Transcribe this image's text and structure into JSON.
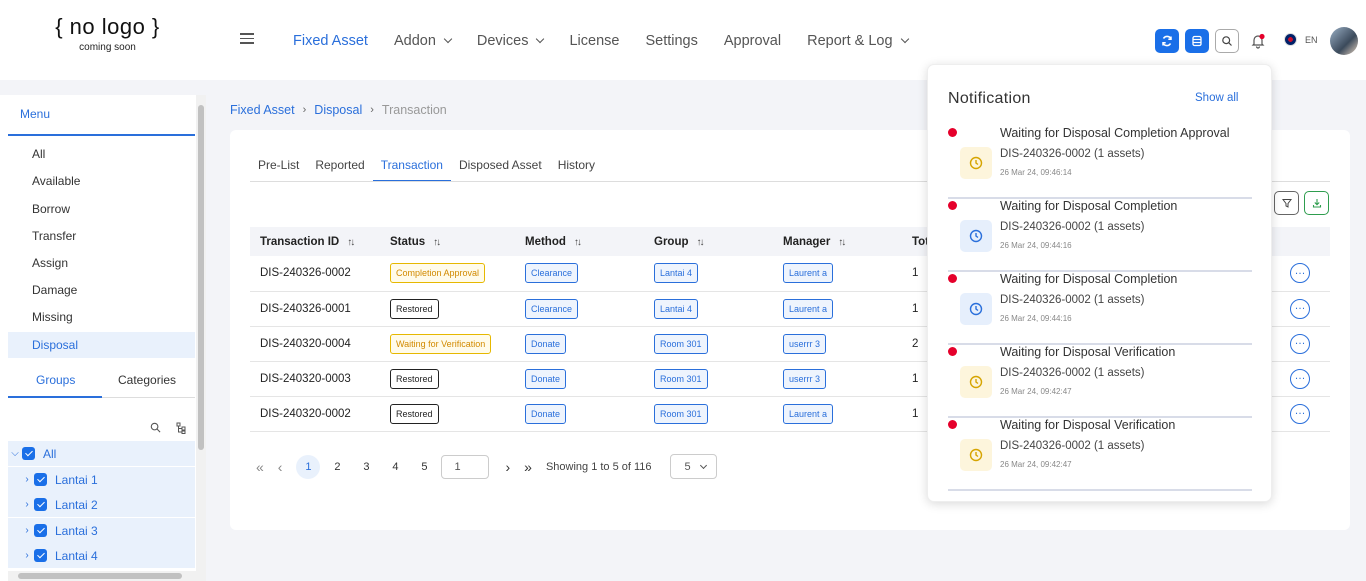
{
  "logo": {
    "line1": "{ no logo }",
    "line2": "coming soon"
  },
  "nav": [
    {
      "label": "Fixed Asset",
      "active": true,
      "dropdown": false
    },
    {
      "label": "Addon",
      "active": false,
      "dropdown": true
    },
    {
      "label": "Devices",
      "active": false,
      "dropdown": true
    },
    {
      "label": "License",
      "active": false,
      "dropdown": false
    },
    {
      "label": "Settings",
      "active": false,
      "dropdown": false
    },
    {
      "label": "Approval",
      "active": false,
      "dropdown": false
    },
    {
      "label": "Report & Log",
      "active": false,
      "dropdown": true
    }
  ],
  "header": {
    "language": "EN"
  },
  "sidebar": {
    "menu_title": "Menu",
    "items": [
      "All",
      "Available",
      "Borrow",
      "Transfer",
      "Assign",
      "Damage",
      "Missing",
      "Disposal"
    ],
    "active_item": "Disposal",
    "tabs": [
      "Groups",
      "Categories"
    ],
    "tree": [
      "All",
      "Lantai 1",
      "Lantai 2",
      "Lantai 3",
      "Lantai 4"
    ]
  },
  "breadcrumb": [
    "Fixed Asset",
    "Disposal",
    "Transaction"
  ],
  "tabs": [
    "Pre-List",
    "Reported",
    "Transaction",
    "Disposed Asset",
    "History"
  ],
  "active_tab": "Transaction",
  "table": {
    "columns": [
      "Transaction ID",
      "Status",
      "Method",
      "Group",
      "Manager",
      "Tot"
    ],
    "rows": [
      {
        "id": "DIS-240326-0002",
        "status": "Completion Approval",
        "status_style": "orange",
        "method": "Clearance",
        "group": "Lantai 4",
        "manager": "Laurent a",
        "total": "1"
      },
      {
        "id": "DIS-240326-0001",
        "status": "Restored",
        "status_style": "dark",
        "method": "Clearance",
        "group": "Lantai 4",
        "manager": "Laurent a",
        "total": "1"
      },
      {
        "id": "DIS-240320-0004",
        "status": "Waiting for Verification",
        "status_style": "orange",
        "method": "Donate",
        "group": "Room 301",
        "manager": "userrr 3",
        "total": "2"
      },
      {
        "id": "DIS-240320-0003",
        "status": "Restored",
        "status_style": "dark",
        "method": "Donate",
        "group": "Room 301",
        "manager": "userrr 3",
        "total": "1"
      },
      {
        "id": "DIS-240320-0002",
        "status": "Restored",
        "status_style": "dark",
        "method": "Donate",
        "group": "Room 301",
        "manager": "Laurent a",
        "total": "1"
      }
    ]
  },
  "pagination": {
    "pages": [
      "1",
      "2",
      "3",
      "4",
      "5"
    ],
    "current": "1",
    "goto_value": "1",
    "showing": "Showing 1 to 5 of 116",
    "page_size": "5"
  },
  "notification": {
    "title": "Notification",
    "show_all": "Show all",
    "items": [
      {
        "title": "Waiting for Disposal Completion Approval",
        "sub": "DIS-240326-0002 (1 assets)",
        "time": "26 Mar 24, 09:46:14",
        "icon_color": "yellow"
      },
      {
        "title": "Waiting for Disposal Completion",
        "sub": "DIS-240326-0002 (1 assets)",
        "time": "26 Mar 24, 09:44:16",
        "icon_color": "blue"
      },
      {
        "title": "Waiting for Disposal Completion",
        "sub": "DIS-240326-0002 (1 assets)",
        "time": "26 Mar 24, 09:44:16",
        "icon_color": "blue"
      },
      {
        "title": "Waiting for Disposal Verification",
        "sub": "DIS-240326-0002 (1 assets)",
        "time": "26 Mar 24, 09:42:47",
        "icon_color": "yellow"
      },
      {
        "title": "Waiting for Disposal Verification",
        "sub": "DIS-240326-0002 (1 assets)",
        "time": "26 Mar 24, 09:42:47",
        "icon_color": "yellow"
      }
    ]
  },
  "colors": {
    "accent": "#2a6fdb",
    "primary_button": "#1a6fe8",
    "unread_dot": "#e5002b",
    "pending_icon": "#d6a400"
  }
}
